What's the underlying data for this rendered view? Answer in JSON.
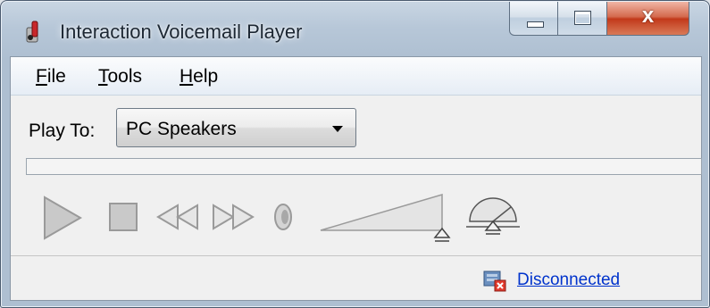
{
  "window": {
    "title": "Interaction Voicemail Player",
    "app_icon": "voicemail-app-icon",
    "caption_buttons": {
      "minimize": "minimize-icon",
      "maximize": "maximize-icon",
      "close_label": "x"
    }
  },
  "menubar": {
    "items": [
      {
        "accel": "F",
        "rest": "ile"
      },
      {
        "accel": "T",
        "rest": "ools"
      },
      {
        "accel": "H",
        "rest": "elp"
      }
    ]
  },
  "play_to": {
    "label": "Play To:",
    "selected": "PC Speakers"
  },
  "progress": {
    "fraction": 0
  },
  "transport": {
    "controls": [
      "play-icon",
      "stop-icon",
      "rewind-icon",
      "fast-forward-icon",
      "speaker-icon",
      "volume-slider",
      "speed-gauge"
    ],
    "volume_level": 1.0,
    "speed_level": 0.5
  },
  "status": {
    "icon": "disconnected-status-icon",
    "link_text": "Disconnected"
  },
  "colors": {
    "link": "#0033cc",
    "close_button": "#c2391a",
    "control_gray": "#b4b4b4"
  }
}
